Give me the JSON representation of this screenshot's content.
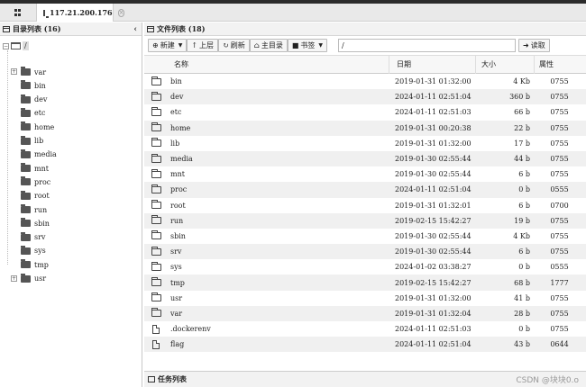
{
  "tab": {
    "host": "117.21.200.176",
    "close": "×"
  },
  "tree_panel": {
    "title": "目录列表 (16)",
    "collapse": "‹",
    "root": "/",
    "items": [
      {
        "name": "var",
        "expandable": true
      },
      {
        "name": "bin",
        "expandable": false
      },
      {
        "name": "dev",
        "expandable": false
      },
      {
        "name": "etc",
        "expandable": false
      },
      {
        "name": "home",
        "expandable": false
      },
      {
        "name": "lib",
        "expandable": false
      },
      {
        "name": "media",
        "expandable": false
      },
      {
        "name": "mnt",
        "expandable": false
      },
      {
        "name": "proc",
        "expandable": false
      },
      {
        "name": "root",
        "expandable": false
      },
      {
        "name": "run",
        "expandable": false
      },
      {
        "name": "sbin",
        "expandable": false
      },
      {
        "name": "srv",
        "expandable": false
      },
      {
        "name": "sys",
        "expandable": false
      },
      {
        "name": "tmp",
        "expandable": false
      },
      {
        "name": "usr",
        "expandable": true
      }
    ]
  },
  "file_panel": {
    "title": "文件列表 (18)",
    "toolbar": {
      "new_label": "新建",
      "up_label": "上层",
      "refresh_label": "刷新",
      "home_label": "主目录",
      "bookmark_label": "书签",
      "path_value": "/",
      "read_label": "读取"
    },
    "columns": {
      "name": "名称",
      "date": "日期",
      "size": "大小",
      "attr": "属性"
    },
    "rows": [
      {
        "type": "folder",
        "name": "bin",
        "date": "2019-01-31 01:32:00",
        "size": "4 Kb",
        "attr": "0755"
      },
      {
        "type": "folder",
        "name": "dev",
        "date": "2024-01-11 02:51:04",
        "size": "360 b",
        "attr": "0755"
      },
      {
        "type": "folder",
        "name": "etc",
        "date": "2024-01-11 02:51:03",
        "size": "66 b",
        "attr": "0755"
      },
      {
        "type": "folder",
        "name": "home",
        "date": "2019-01-31 00:20:38",
        "size": "22 b",
        "attr": "0755"
      },
      {
        "type": "folder",
        "name": "lib",
        "date": "2019-01-31 01:32:00",
        "size": "17 b",
        "attr": "0755"
      },
      {
        "type": "folder",
        "name": "media",
        "date": "2019-01-30 02:55:44",
        "size": "44 b",
        "attr": "0755"
      },
      {
        "type": "folder",
        "name": "mnt",
        "date": "2019-01-30 02:55:44",
        "size": "6 b",
        "attr": "0755"
      },
      {
        "type": "folder",
        "name": "proc",
        "date": "2024-01-11 02:51:04",
        "size": "0 b",
        "attr": "0555"
      },
      {
        "type": "folder",
        "name": "root",
        "date": "2019-01-31 01:32:01",
        "size": "6 b",
        "attr": "0700"
      },
      {
        "type": "folder",
        "name": "run",
        "date": "2019-02-15 15:42:27",
        "size": "19 b",
        "attr": "0755"
      },
      {
        "type": "folder",
        "name": "sbin",
        "date": "2019-01-30 02:55:44",
        "size": "4 Kb",
        "attr": "0755"
      },
      {
        "type": "folder",
        "name": "srv",
        "date": "2019-01-30 02:55:44",
        "size": "6 b",
        "attr": "0755"
      },
      {
        "type": "folder",
        "name": "sys",
        "date": "2024-01-02 03:38:27",
        "size": "0 b",
        "attr": "0555"
      },
      {
        "type": "folder",
        "name": "tmp",
        "date": "2019-02-15 15:42:27",
        "size": "68 b",
        "attr": "1777"
      },
      {
        "type": "folder",
        "name": "usr",
        "date": "2019-01-31 01:32:00",
        "size": "41 b",
        "attr": "0755"
      },
      {
        "type": "folder",
        "name": "var",
        "date": "2019-01-31 01:32:04",
        "size": "28 b",
        "attr": "0755"
      },
      {
        "type": "file",
        "name": ".dockerenv",
        "date": "2024-01-11 02:51:03",
        "size": "0 b",
        "attr": "0755"
      },
      {
        "type": "file",
        "name": "flag",
        "date": "2024-01-11 02:51:04",
        "size": "43 b",
        "attr": "0644"
      }
    ]
  },
  "task_panel": {
    "title": "任务列表"
  },
  "watermark": "CSDN @块块0.o"
}
